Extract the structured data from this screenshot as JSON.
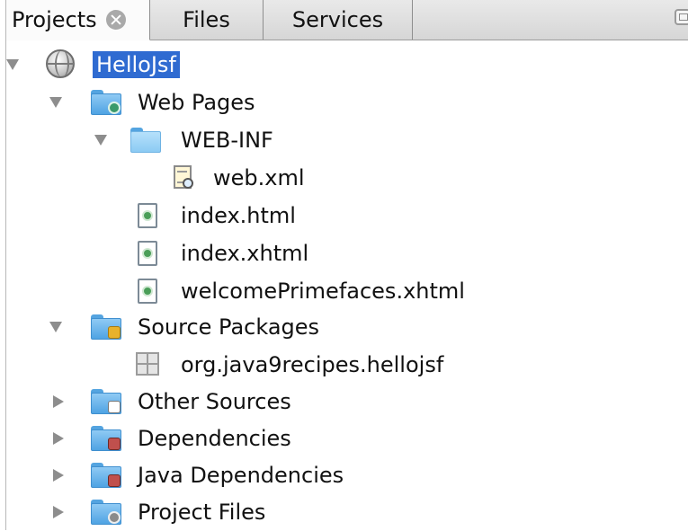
{
  "tabs": {
    "projects_label": "Projects",
    "files_label": "Files",
    "services_label": "Services"
  },
  "tree": {
    "project": {
      "label": "HelloJsf",
      "icon": "web-project-globe-icon",
      "expanded": true,
      "selected": true
    },
    "web_pages": {
      "label": "Web Pages",
      "icon": "web-pages-folder-icon",
      "expanded": true
    },
    "web_inf": {
      "label": "WEB-INF",
      "icon": "folder-icon",
      "expanded": true
    },
    "web_xml": {
      "label": "web.xml",
      "icon": "xml-config-file-icon"
    },
    "index_html": {
      "label": "index.html",
      "icon": "html-file-icon"
    },
    "index_xhtml": {
      "label": "index.xhtml",
      "icon": "xhtml-file-icon"
    },
    "welcome": {
      "label": "welcomePrimefaces.xhtml",
      "icon": "xhtml-file-icon"
    },
    "source_packages": {
      "label": "Source Packages",
      "icon": "source-packages-folder-icon",
      "expanded": true
    },
    "package": {
      "label": "org.java9recipes.hellojsf",
      "icon": "java-package-icon"
    },
    "other_sources": {
      "label": "Other Sources",
      "icon": "other-sources-folder-icon",
      "expanded": false
    },
    "dependencies": {
      "label": "Dependencies",
      "icon": "dependencies-folder-icon",
      "expanded": false
    },
    "java_dependencies": {
      "label": "Java Dependencies",
      "icon": "java-dependencies-folder-icon",
      "expanded": false
    },
    "project_files": {
      "label": "Project Files",
      "icon": "project-files-folder-icon",
      "expanded": false
    }
  },
  "colors": {
    "selection": "#2f6bd1",
    "folder": "#4fa3e3",
    "toggle": "#8d8d8d"
  }
}
